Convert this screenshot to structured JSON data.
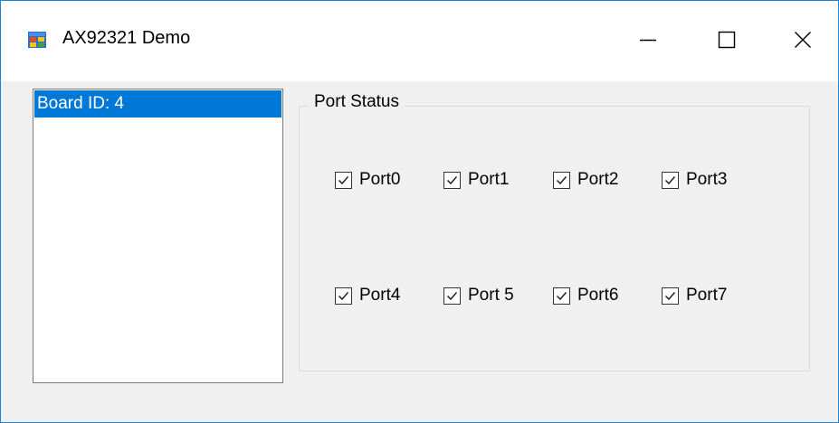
{
  "window": {
    "title": "AX92321 Demo"
  },
  "board_list": {
    "items": [
      {
        "label": "Board ID: 4",
        "selected": true
      }
    ]
  },
  "port_status": {
    "title": "Port Status",
    "ports": [
      {
        "label": "Port0",
        "checked": true
      },
      {
        "label": "Port1",
        "checked": true
      },
      {
        "label": "Port2",
        "checked": true
      },
      {
        "label": "Port3",
        "checked": true
      },
      {
        "label": "Port4",
        "checked": true
      },
      {
        "label": "Port 5",
        "checked": true
      },
      {
        "label": "Port6",
        "checked": true
      },
      {
        "label": "Port7",
        "checked": true
      }
    ]
  },
  "colors": {
    "selection": "#0078d7",
    "window_border": "#1883d7"
  },
  "icons": {
    "app": "app-window-icon",
    "minimize": "minimize-icon",
    "maximize": "maximize-icon",
    "close": "close-icon",
    "check": "checkmark-icon"
  }
}
